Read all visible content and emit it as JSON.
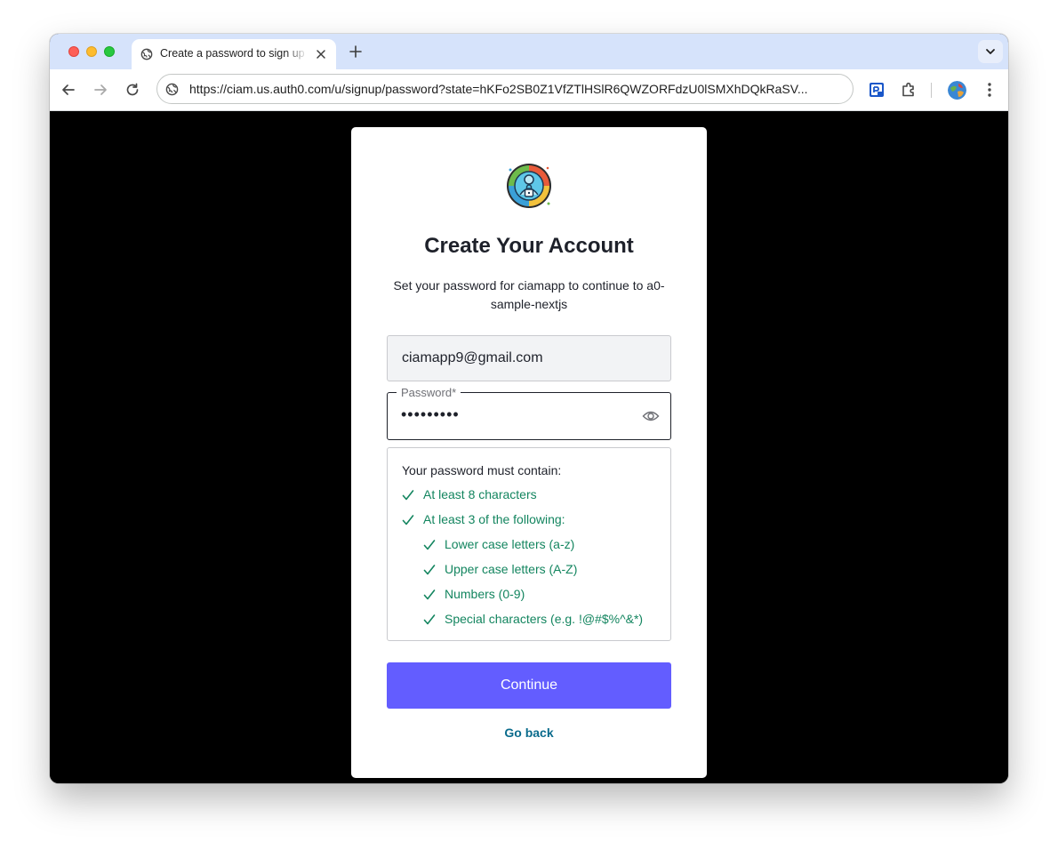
{
  "browser": {
    "tab_title": "Create a password to sign up",
    "url": "https://ciam.us.auth0.com/u/signup/password?state=hKFo2SB0Z1VfZTlHSlR6QWZORFdzU0lSMXhDQkRaSV..."
  },
  "card": {
    "title": "Create Your Account",
    "subtitle": "Set your password for ciamapp to continue to a0-sample-nextjs",
    "email_value": "ciamapp9@gmail.com",
    "password_label": "Password*",
    "password_value": "•••••••••",
    "requirements": {
      "heading": "Your password must contain:",
      "items": [
        "At least 8 characters",
        "At least 3 of the following:",
        "Lower case letters (a-z)",
        "Upper case letters (A-Z)",
        "Numbers (0-9)",
        "Special characters (e.g. !@#$%^&*)"
      ]
    },
    "continue_label": "Continue",
    "go_back_label": "Go back"
  },
  "colors": {
    "primary_button": "#635dff",
    "success_text": "#13855f",
    "link": "#0a6b8c"
  }
}
